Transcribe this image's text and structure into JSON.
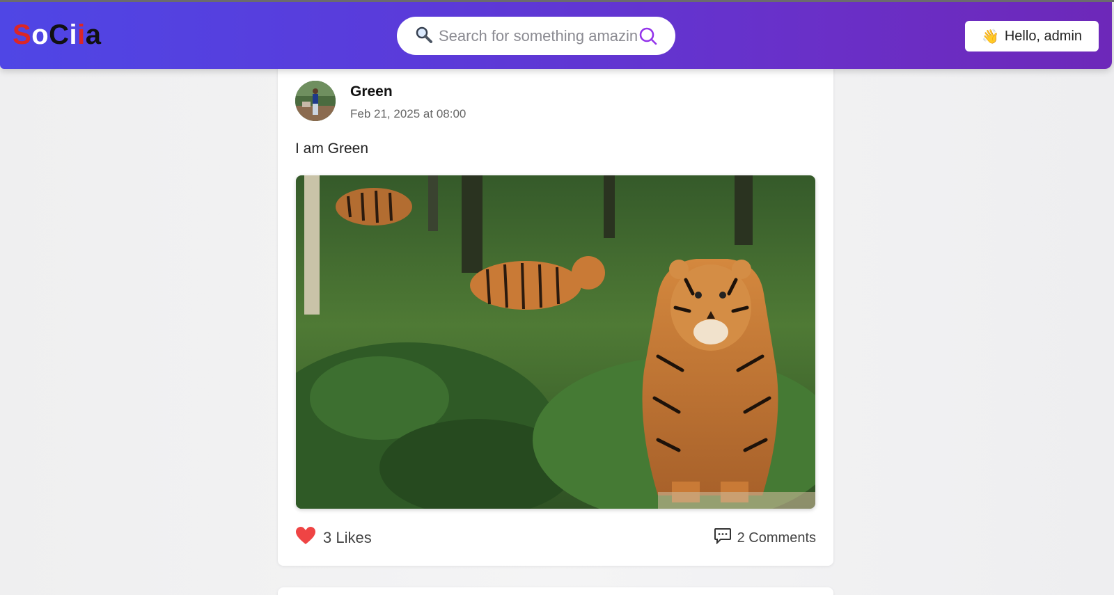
{
  "app": {
    "logo_letters": [
      "S",
      "o",
      "C",
      "i",
      "i",
      "a"
    ]
  },
  "header": {
    "search_placeholder": "Search for something amazing",
    "greeting": "Hello, admin"
  },
  "post": {
    "author": "Green",
    "date": "Feb 21, 2025 at 08:00",
    "text": "I am Green",
    "likes_label": "3 Likes",
    "comments_label": "2 Comments"
  },
  "colors": {
    "nav_gradient_start": "#4f46e5",
    "nav_gradient_end": "#6d28b9",
    "logo_red": "#dc2626",
    "like_heart": "#ef4444",
    "search_icon": "#9333ea"
  },
  "icons": [
    "magnifier-icon",
    "search-icon",
    "waving-hand-icon",
    "heart-icon",
    "comment-icon"
  ]
}
